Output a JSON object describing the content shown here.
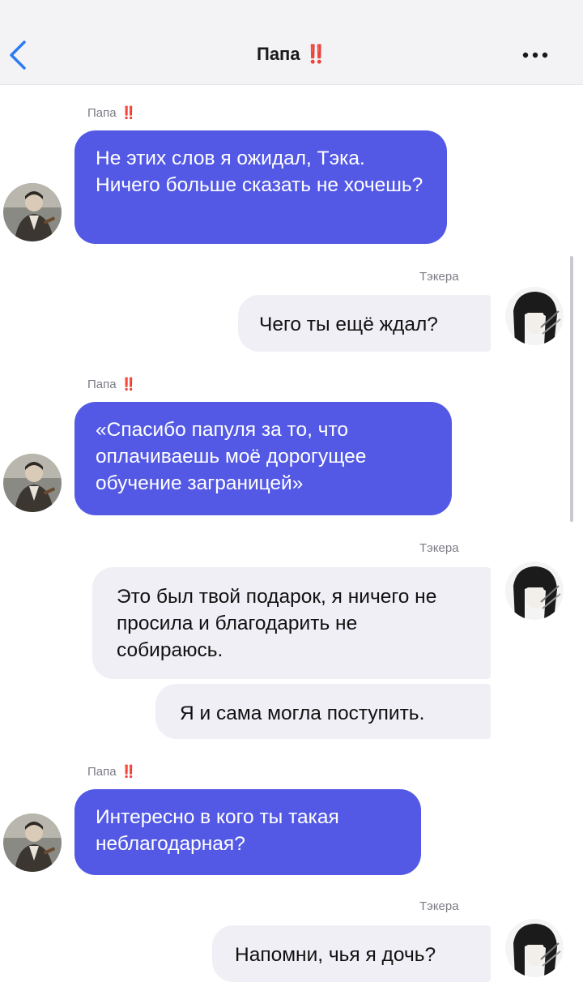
{
  "header": {
    "title": "Папа",
    "title_mark": "‼️",
    "back_icon": "chevron-left-icon",
    "more_icon": "more-dots-icon"
  },
  "contacts": {
    "father": {
      "name": "Папа",
      "mark": "‼️"
    },
    "me": {
      "name": "Тэкера"
    }
  },
  "messages": [
    {
      "from": "father",
      "text": "Не этих слов я ожидал, Тэка. Ничего больше сказать не хочешь?"
    },
    {
      "from": "me",
      "text": "Чего ты ещё ждал?"
    },
    {
      "from": "father",
      "text": "«Спасибо папуля за то, что оплачиваешь моё дорогущее обучение заграницей»"
    },
    {
      "from": "me",
      "text": "Это был твой подарок, я ничего не просила и благодарить не собираюсь."
    },
    {
      "from": "me",
      "text": "Я и сама могла поступить."
    },
    {
      "from": "father",
      "text": "Интересно в кого ты такая неблагодарная?"
    },
    {
      "from": "me",
      "text": "Напомни, чья я дочь?"
    }
  ],
  "colors": {
    "incoming_bubble": "#5359e4",
    "outgoing_bubble": "#f0eff6",
    "mark_red": "#e8321c",
    "header_bg": "#f3f3f6"
  }
}
